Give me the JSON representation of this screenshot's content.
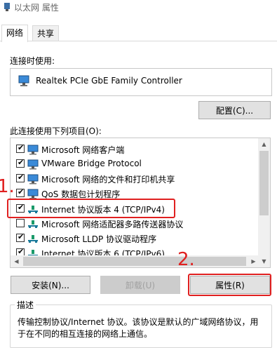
{
  "window": {
    "title": "以太网 属性"
  },
  "tabs": [
    {
      "label": "网络"
    },
    {
      "label": "共享"
    }
  ],
  "connect_using": {
    "label": "连接时使用:",
    "adapter": "Realtek PCIe GbE Family Controller",
    "configure_button": "配置(C)..."
  },
  "items_section": {
    "label": "此连接使用下列项目(O):",
    "items": [
      {
        "label": "Microsoft 网络客户端",
        "checked": true,
        "icon": "network-client-icon"
      },
      {
        "label": "VMware Bridge Protocol",
        "checked": true,
        "icon": "network-client-icon"
      },
      {
        "label": "Microsoft 网络的文件和打印机共享",
        "checked": true,
        "icon": "network-client-icon"
      },
      {
        "label": "QoS 数据包计划程序",
        "checked": true,
        "icon": "network-client-icon"
      },
      {
        "label": "Internet 协议版本 4 (TCP/IPv4)",
        "checked": true,
        "icon": "protocol-icon"
      },
      {
        "label": "Microsoft 网络适配器多路传送器协议",
        "checked": false,
        "icon": "protocol-icon"
      },
      {
        "label": "Microsoft LLDP 协议驱动程序",
        "checked": true,
        "icon": "protocol-icon"
      },
      {
        "label": "Internet 协议版本 6 (TCP/IPv6)",
        "checked": true,
        "icon": "protocol-icon"
      }
    ]
  },
  "buttons": {
    "install": "安装(N)...",
    "uninstall": "卸载(U)",
    "properties": "属性(R)"
  },
  "description": {
    "label": "描述",
    "text": "传输控制协议/Internet 协议。该协议是默认的广域网络协议，用于在不同的相互连接的网络上通信。"
  },
  "annotations": {
    "one": "1.",
    "two": "2."
  },
  "colors": {
    "annotation": "#e02020",
    "selected_bg": "#ffffff"
  }
}
